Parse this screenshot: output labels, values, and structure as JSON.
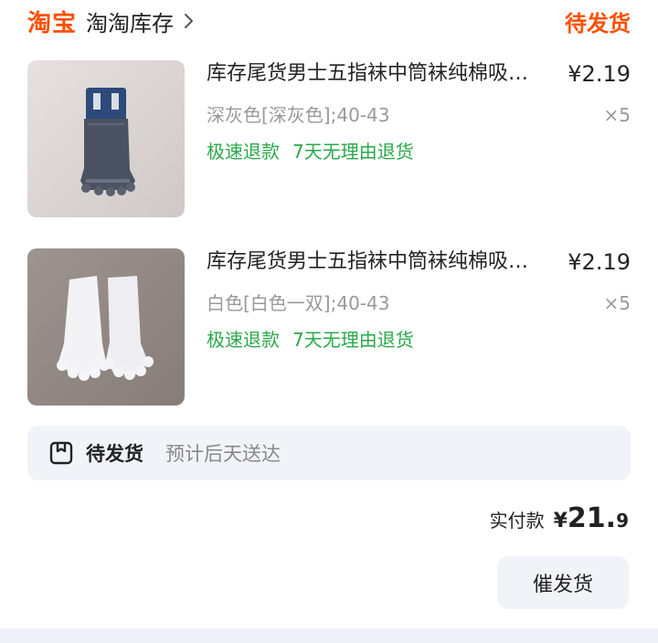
{
  "header": {
    "brand": "淘宝",
    "store_name": "淘淘库存",
    "order_status": "待发货"
  },
  "items": [
    {
      "title": "库存尾货男士五指袜中筒袜纯棉吸汗防臭",
      "price": "¥2.19",
      "spec": "深灰色[深灰色];40-43",
      "qty": "×5",
      "tags": [
        "极速退款",
        "7天无理由退货"
      ],
      "image": "dark-gray-toe-socks"
    },
    {
      "title": "库存尾货男士五指袜中筒袜纯棉吸汗防臭",
      "price": "¥2.19",
      "spec": "白色[白色一双];40-43",
      "qty": "×5",
      "tags": [
        "极速退款",
        "7天无理由退货"
      ],
      "image": "white-toe-socks"
    }
  ],
  "shipping": {
    "icon": "package-icon",
    "status": "待发货",
    "estimate": "预计后天送达"
  },
  "payment": {
    "label": "实付款",
    "currency": "¥",
    "amount_int": "21.",
    "amount_dec": "9"
  },
  "actions": {
    "urge_label": "催发货"
  },
  "colors": {
    "brand": "#ff5000",
    "tag_green": "#2aa94a",
    "muted": "#999999",
    "strip_bg": "#f0f4f9"
  }
}
